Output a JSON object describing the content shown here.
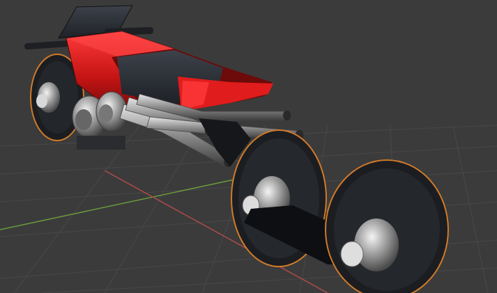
{
  "viewport": {
    "background": "#3b3b3b",
    "grid_color": "#4a4a4a",
    "x_axis_color": "#b04a4a",
    "y_axis_color": "#6a9a3a"
  },
  "model": {
    "body_color": "#d01818",
    "body_highlight": "#ff3030",
    "panel_dark": "#2b2f36",
    "chrome": "#b8b8b8",
    "tire_color": "#1b1d21",
    "rim_accent": "#d07a2a",
    "arm_color": "#101216"
  }
}
